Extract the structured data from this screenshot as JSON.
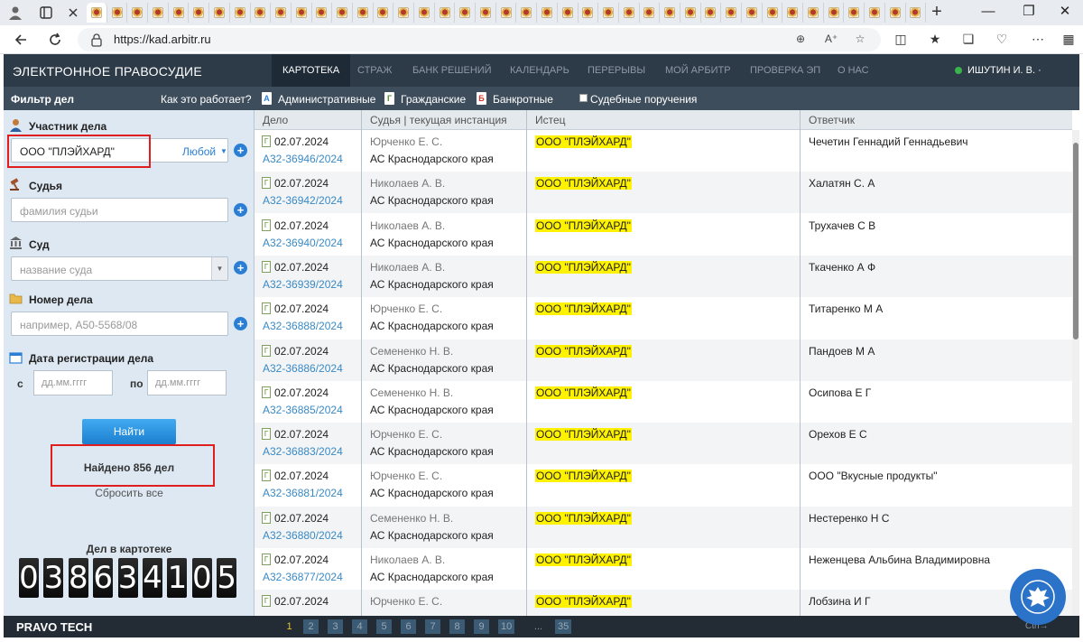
{
  "browser": {
    "url": "https://kad.arbitr.ru",
    "tab_count": 41,
    "new_tab": "+"
  },
  "site": {
    "title": "ЭЛЕКТРОННОЕ ПРАВОСУДИЕ",
    "nav": [
      "КАРТОТЕКА",
      "СТРАЖ",
      "БАНК РЕШЕНИЙ",
      "КАЛЕНДАРЬ",
      "ПЕРЕРЫВЫ",
      "МОЙ АРБИТР",
      "ПРОВЕРКА ЭП",
      "О НАС"
    ],
    "user": "ИШУТИН И. В. · ВЫЙТИ"
  },
  "filter_bar": {
    "title": "Фильтр дел",
    "how": "Как это работает?",
    "types": [
      {
        "icon": "А",
        "label": "Административные",
        "color": "#2a7fd4"
      },
      {
        "icon": "Г",
        "label": "Гражданские",
        "color": "#4a8a2a"
      },
      {
        "icon": "Б",
        "label": "Банкротные",
        "color": "#d03a2a"
      }
    ],
    "court_orders": "Судебные поручения"
  },
  "filters": {
    "participant_label": "Участник дела",
    "participant_value": "ООО \"ПЛЭЙХАРД\"",
    "participant_role": "Любой",
    "judge_label": "Судья",
    "judge_placeholder": "фамилия судьи",
    "court_label": "Суд",
    "court_placeholder": "название суда",
    "case_label": "Номер дела",
    "case_placeholder": "например, А50-5568/08",
    "date_label": "Дата регистрации дела",
    "date_from": "с",
    "date_to": "по",
    "date_placeholder": "дд.мм.гггг",
    "search_button": "Найти",
    "found": "Найдено 856 дел",
    "reset": "Сбросить все",
    "counter_label": "Дел в картотеке",
    "counter_digits": [
      "0",
      "3",
      "8",
      "6",
      "3",
      "4",
      "1",
      "0",
      "5"
    ]
  },
  "table": {
    "headers": [
      "Дело",
      "Судья | текущая инстанция",
      "Истец",
      "Ответчик"
    ],
    "rows": [
      {
        "date": "02.07.2024",
        "number": "А32-36946/2024",
        "judge": "Юрченко Е. С.",
        "court": "АС Краснодарского края",
        "plaintiff": "ООО \"ПЛЭЙХАРД\"",
        "respondent": "Чечетин Геннадий Геннадьевич"
      },
      {
        "date": "02.07.2024",
        "number": "А32-36942/2024",
        "judge": "Николаев А. В.",
        "court": "АС Краснодарского края",
        "plaintiff": "ООО \"ПЛЭЙХАРД\"",
        "respondent": "Халатян С. А"
      },
      {
        "date": "02.07.2024",
        "number": "А32-36940/2024",
        "judge": "Николаев А. В.",
        "court": "АС Краснодарского края",
        "plaintiff": "ООО \"ПЛЭЙХАРД\"",
        "respondent": "Трухачев С В"
      },
      {
        "date": "02.07.2024",
        "number": "А32-36939/2024",
        "judge": "Николаев А. В.",
        "court": "АС Краснодарского края",
        "plaintiff": "ООО \"ПЛЭЙХАРД\"",
        "respondent": "Ткаченко А Ф"
      },
      {
        "date": "02.07.2024",
        "number": "А32-36888/2024",
        "judge": "Юрченко Е. С.",
        "court": "АС Краснодарского края",
        "plaintiff": "ООО \"ПЛЭЙХАРД\"",
        "respondent": "Титаренко М А"
      },
      {
        "date": "02.07.2024",
        "number": "А32-36886/2024",
        "judge": "Семененко Н. В.",
        "court": "АС Краснодарского края",
        "plaintiff": "ООО \"ПЛЭЙХАРД\"",
        "respondent": "Пандоев М А"
      },
      {
        "date": "02.07.2024",
        "number": "А32-36885/2024",
        "judge": "Семененко Н. В.",
        "court": "АС Краснодарского края",
        "plaintiff": "ООО \"ПЛЭЙХАРД\"",
        "respondent": "Осипова Е Г"
      },
      {
        "date": "02.07.2024",
        "number": "А32-36883/2024",
        "judge": "Юрченко Е. С.",
        "court": "АС Краснодарского края",
        "plaintiff": "ООО \"ПЛЭЙХАРД\"",
        "respondent": "Орехов Е С"
      },
      {
        "date": "02.07.2024",
        "number": "А32-36881/2024",
        "judge": "Юрченко Е. С.",
        "court": "АС Краснодарского края",
        "plaintiff": "ООО \"ПЛЭЙХАРД\"",
        "respondent": "ООО \"Вкусные продукты\""
      },
      {
        "date": "02.07.2024",
        "number": "А32-36880/2024",
        "judge": "Семененко Н. В.",
        "court": "АС Краснодарского края",
        "plaintiff": "ООО \"ПЛЭЙХАРД\"",
        "respondent": "Нестеренко Н С"
      },
      {
        "date": "02.07.2024",
        "number": "А32-36877/2024",
        "judge": "Николаев А. В.",
        "court": "АС Краснодарского края",
        "plaintiff": "ООО \"ПЛЭЙХАРД\"",
        "respondent": "Неженцева Альбина Владимировна"
      },
      {
        "date": "02.07.2024",
        "number": "",
        "judge": "Юрченко Е. С.",
        "court": "",
        "plaintiff": "ООО \"ПЛЭЙХАРД\"",
        "respondent": "Лобзина И Г"
      }
    ]
  },
  "footer": {
    "brand": "PRAVO TECH",
    "pages": [
      "1",
      "2",
      "3",
      "4",
      "5",
      "6",
      "7",
      "8",
      "9",
      "10",
      "...",
      "35"
    ],
    "current_page": "1",
    "hint": "Ctrl→"
  }
}
